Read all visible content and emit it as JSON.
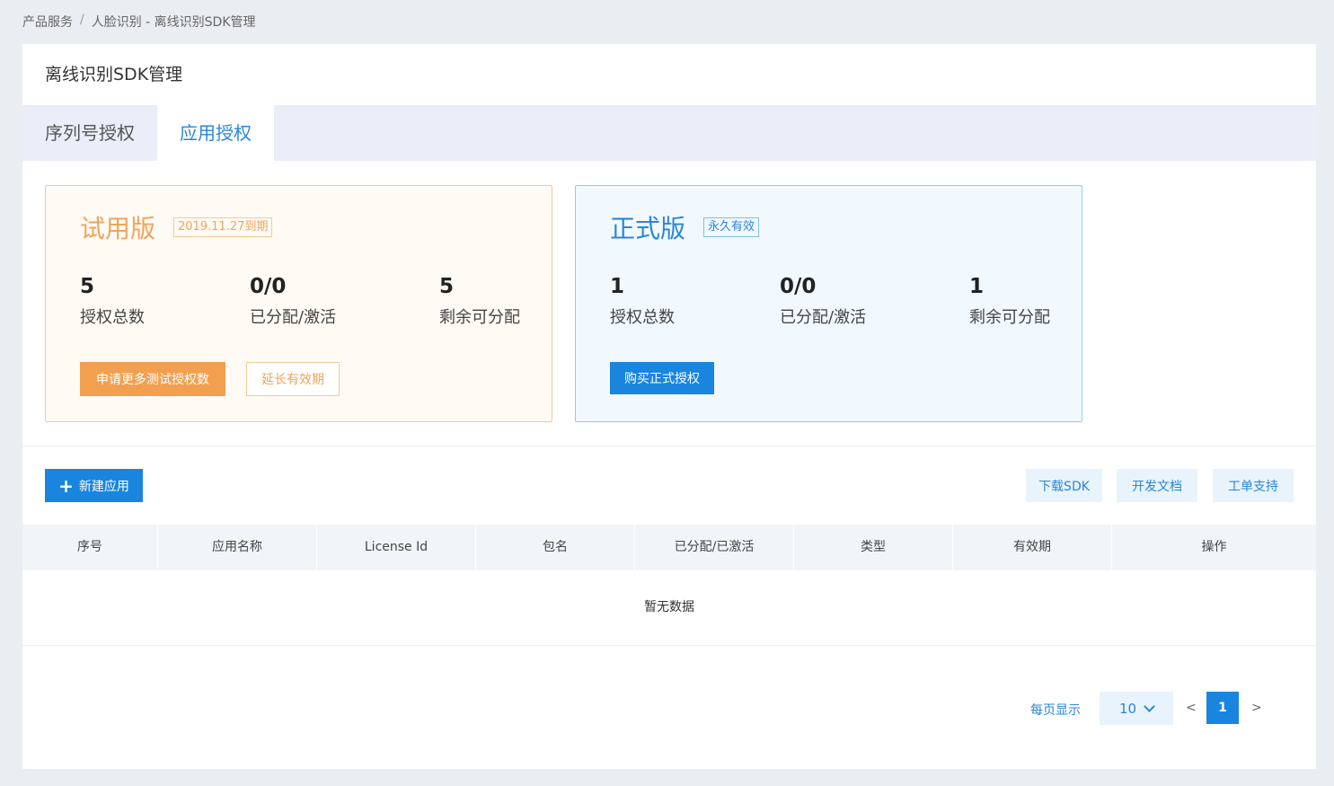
{
  "breadcrumb": {
    "item1": "产品服务",
    "separator": "/",
    "item2": "人脸识别 - 离线识别SDK管理"
  },
  "page_title": "离线识别SDK管理",
  "tabs": [
    {
      "label": "序列号授权",
      "active": false
    },
    {
      "label": "应用授权",
      "active": true
    }
  ],
  "trial": {
    "title": "试用版",
    "badge": "2019.11.27到期",
    "stats": [
      {
        "num": "5",
        "label": "授权总数"
      },
      {
        "num": "0/0",
        "label": "已分配/激活"
      },
      {
        "num": "5",
        "label": "剩余可分配"
      }
    ],
    "apply_button": "申请更多测试授权数",
    "extend_button": "延长有效期"
  },
  "formal": {
    "title": "正式版",
    "badge": "永久有效",
    "stats": [
      {
        "num": "1",
        "label": "授权总数"
      },
      {
        "num": "0/0",
        "label": "已分配/激活"
      },
      {
        "num": "1",
        "label": "剩余可分配"
      }
    ],
    "buy_button": "购买正式授权"
  },
  "toolbar": {
    "new_app": "新建应用",
    "download_sdk": "下载SDK",
    "dev_docs": "开发文档",
    "ticket_support": "工单支持"
  },
  "table": {
    "columns": [
      "序号",
      "应用名称",
      "License Id",
      "包名",
      "已分配/已激活",
      "类型",
      "有效期",
      "操作"
    ],
    "empty_text": "暂无数据"
  },
  "pagination": {
    "per_page_label": "每页显示",
    "per_page_value": "10",
    "prev": "<",
    "current_page": "1",
    "next": ">"
  },
  "colors": {
    "accent_blue": "#1a85df",
    "accent_orange": "#f2a050"
  }
}
